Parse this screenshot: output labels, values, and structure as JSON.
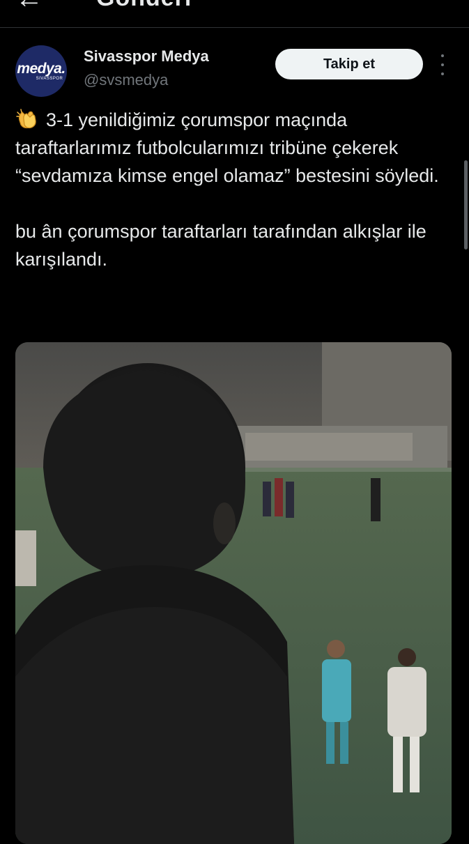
{
  "header": {
    "back_icon": "arrow-left-icon",
    "title": "Gönderi"
  },
  "tweet": {
    "avatar": {
      "logo_text": "medya.",
      "logo_sub": "SIVASSPOR",
      "bg_color": "#1e2a66"
    },
    "display_name": "Sivasspor Medya",
    "handle": "@svsmedya",
    "follow_label": "Takip et",
    "more_icon": "more-vertical-icon",
    "emoji_icon": "clapping-hands-icon",
    "text_para1": "3-1 yenildiğimiz çorumspor maçında taraftarlarımız futbolcularımızı tribüne çekerek “sevdamıza kimse engel olamaz” bestesini söyledi.",
    "text_para2": "bu ân çorumspor taraftarları tarafından alkışlar ile karışılandı."
  },
  "colors": {
    "background": "#000000",
    "text": "#e7e9ea",
    "muted": "#71767b",
    "follow_bg": "#eff3f4",
    "divider": "#2f3336"
  }
}
